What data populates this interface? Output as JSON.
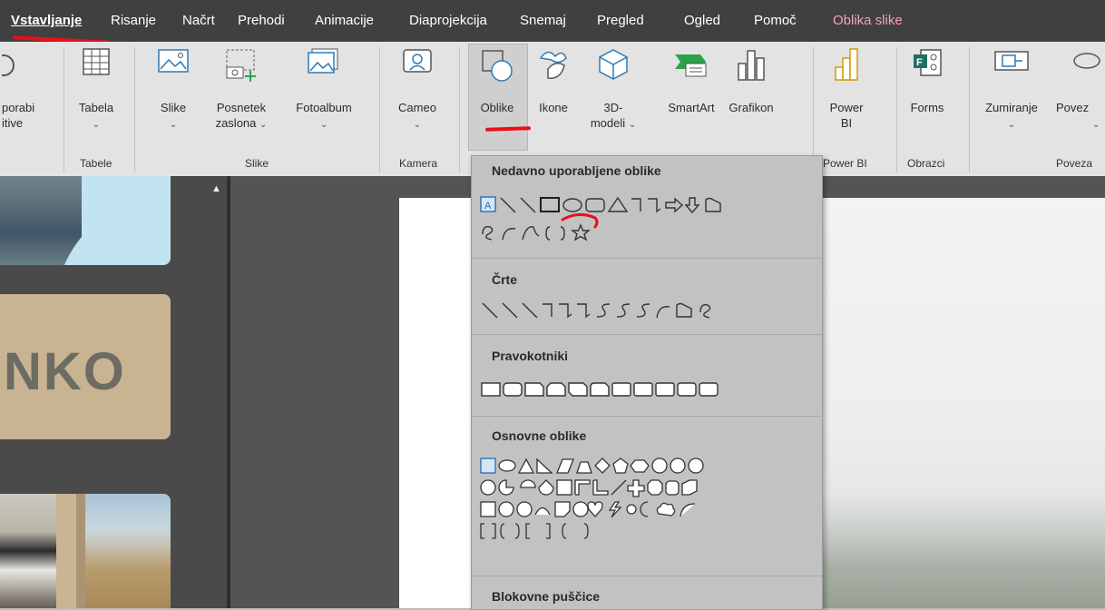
{
  "menu": {
    "tabs": [
      "Vstavljanje",
      "Risanje",
      "Načrt",
      "Prehodi",
      "Animacije",
      "Diaprojekcija",
      "Snemaj",
      "Pregled",
      "Ogled",
      "Pomoč",
      "Oblika slike"
    ]
  },
  "ribbon": {
    "uporabi_1": "porabi",
    "uporabi_2": "itive",
    "tabela": "Tabela",
    "slike": "Slike",
    "posnetek_1": "Posnetek",
    "posnetek_2": "zaslona",
    "fotoalbum": "Fotoalbum",
    "cameo": "Cameo",
    "oblike": "Oblike",
    "ikone": "Ikone",
    "modeli_1": "3D-",
    "modeli_2": "modeli",
    "smartart": "SmartArt",
    "grafikon": "Grafikon",
    "powerbi_1": "Power",
    "powerbi_2": "BI",
    "forms": "Forms",
    "zumiranje": "Zumiranje",
    "povez": "Povez",
    "chevron": "⌄",
    "groups": {
      "tabele": "Tabele",
      "slike": "Slike",
      "kamera": "Kamera",
      "powerbi": "Power BI",
      "obrazci": "Obrazci",
      "poveza": "Poveza"
    }
  },
  "thumbs": {
    "nko": "NKO"
  },
  "shapes_menu": {
    "recent": "Nedavno uporabljene oblike",
    "lines": "Črte",
    "rectangles": "Pravokotniki",
    "basic": "Osnovne oblike",
    "block_arrows": "Blokovne puščice",
    "recent_row1": "\\ \\ ○ ▭ △ ⌐ ⌐ ⇨ ⇩ ◔",
    "recent_row2": "ᘓ ⌒ ⌒ { } ☆",
    "lines_row": "\\ \\ \\ ⌐ ⌐ ⌐ ⌐ Ƨ Ƨ Ƨ ⌒ ◔ ᘓ",
    "basic_row1": "○ △ ◺ ▱ ⏢ ◇ ⬠ ⬡ ⑦ ⑧ ⑩",
    "basic_row2": "⑫ ◔ ◐ ◓ ▣ ⌜ ⌞ ╱ ✚ ⯃ ⌭ ⬡",
    "basic_row3": "◙ ◎ ⊘ ⌒ ▱ ☺ ♡ ⚡ ☼ ☾ ☁ ⌒",
    "basic_row4": "[ ] { } [ ] { }"
  },
  "colors": {
    "menubar": "#404040",
    "ribbon": "#e3e3e3",
    "dropdown": "#c2c2c2",
    "annotation_red": "#e8101a",
    "context_tab": "#f4a3b6"
  }
}
